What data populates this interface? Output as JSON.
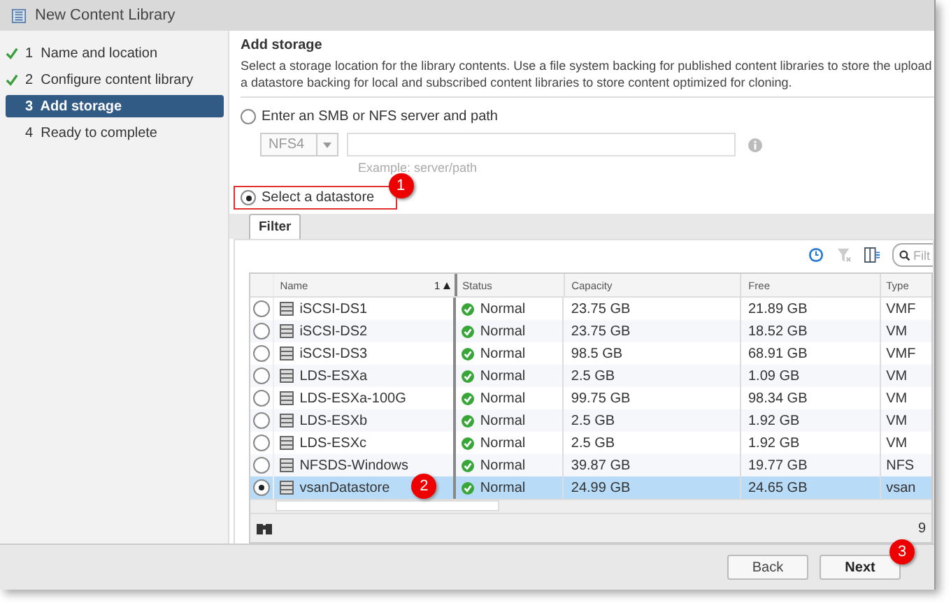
{
  "window": {
    "title": "New Content Library"
  },
  "steps": [
    {
      "number": "1",
      "label": "Name and location",
      "done": true,
      "selected": false
    },
    {
      "number": "2",
      "label": "Configure content library",
      "done": true,
      "selected": false
    },
    {
      "number": "3",
      "label": "Add storage",
      "done": false,
      "selected": true
    },
    {
      "number": "4",
      "label": "Ready to complete",
      "done": false,
      "selected": false
    }
  ],
  "section": {
    "title": "Add storage",
    "description": [
      "Select a storage location for the library contents. Use a file system backing for published content libraries to store the upload",
      "a datastore backing for local and subscribed content libraries to store content optimized for cloning."
    ]
  },
  "options": [
    {
      "label": "Enter an SMB or NFS server and path",
      "selected": false
    },
    {
      "label": "Select a datastore",
      "selected": true
    }
  ],
  "nfs": {
    "protocol": "NFS4",
    "hint": "Example: server/path",
    "disabled": true
  },
  "tabs": [
    {
      "label": "Filter",
      "selected": true
    }
  ],
  "search": {
    "placeholder": "Filt"
  },
  "table": {
    "columns": [
      "Name",
      "Status",
      "Capacity",
      "Free",
      "Type"
    ],
    "sort": "1",
    "rows": [
      {
        "name": "iSCSI-DS1",
        "status": "Normal",
        "capacity": "23.75  GB",
        "free": "21.89  GB",
        "type": "VMF",
        "selected": false
      },
      {
        "name": "iSCSI-DS2",
        "status": "Normal",
        "capacity": "23.75  GB",
        "free": "18.52  GB",
        "type": "VM",
        "selected": false
      },
      {
        "name": "iSCSI-DS3",
        "status": "Normal",
        "capacity": "98.5  GB",
        "free": "68.91  GB",
        "type": "VMF",
        "selected": false
      },
      {
        "name": "LDS-ESXa",
        "status": "Normal",
        "capacity": "2.5  GB",
        "free": "1.09  GB",
        "type": "VM",
        "selected": false
      },
      {
        "name": "LDS-ESXa-100G",
        "status": "Normal",
        "capacity": "99.75  GB",
        "free": "98.34  GB",
        "type": "VM",
        "selected": false
      },
      {
        "name": "LDS-ESXb",
        "status": "Normal",
        "capacity": "2.5  GB",
        "free": "1.92  GB",
        "type": "VM",
        "selected": false
      },
      {
        "name": "LDS-ESXc",
        "status": "Normal",
        "capacity": "2.5  GB",
        "free": "1.92  GB",
        "type": "VM",
        "selected": false
      },
      {
        "name": "NFSDS-Windows",
        "status": "Normal",
        "capacity": "39.87  GB",
        "free": "19.77  GB",
        "type": "NFS",
        "selected": false
      },
      {
        "name": "vsanDatastore",
        "status": "Normal",
        "capacity": "24.99  GB",
        "free": "24.65  GB",
        "type": "vsan",
        "selected": true
      }
    ],
    "count": "9"
  },
  "buttons": [
    {
      "label": "Back",
      "kind": "secondary"
    },
    {
      "label": "Next",
      "kind": "primary"
    }
  ],
  "callouts": [
    "1",
    "2",
    "3"
  ]
}
